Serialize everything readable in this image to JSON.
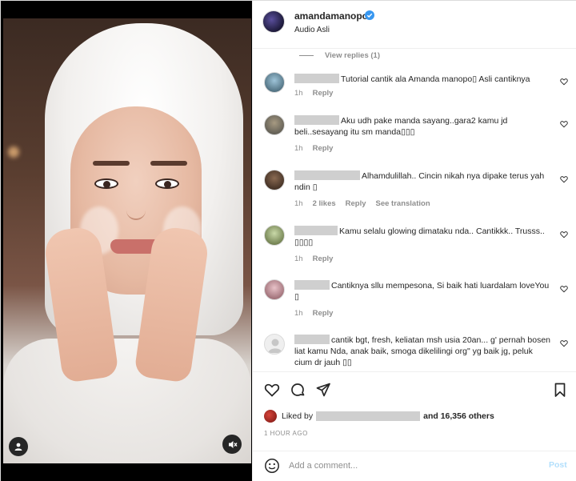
{
  "post": {
    "username": "amandamanopo",
    "audio": "Audio Asli",
    "view_replies": "View replies (1)"
  },
  "comments": [
    {
      "text": "Tutorial cantik ala Amanda manopo▯ Asli cantiknya",
      "time": "1h",
      "likes": "",
      "reply": "Reply",
      "translate": ""
    },
    {
      "text": "Aku udh pake manda sayang..gara2 kamu jd beli..sesayang itu sm manda▯▯▯",
      "time": "1h",
      "likes": "",
      "reply": "Reply",
      "translate": ""
    },
    {
      "text": "Alhamdulillah.. Cincin nikah nya dipake terus yah ndin ▯",
      "time": "1h",
      "likes": "2 likes",
      "reply": "Reply",
      "translate": "See translation"
    },
    {
      "text": "Kamu selalu glowing dimataku nda.. Cantikkk.. Trusss.. ▯▯▯▯",
      "time": "1h",
      "likes": "",
      "reply": "Reply",
      "translate": ""
    },
    {
      "text": "Cantiknya sllu mempesona, Si baik hati luardalam loveYou ▯",
      "time": "1h",
      "likes": "",
      "reply": "Reply",
      "translate": ""
    },
    {
      "text": "cantik bgt, fresh, keliatan msh usia 20an... g' pernah bosen liat kamu Nda, anak baik, smoga dikelilingi org\" yg baik jg, peluk cium dr jauh ▯▯",
      "time": "",
      "likes": "",
      "reply": "",
      "translate": ""
    }
  ],
  "likes": {
    "prefix": "Liked by",
    "others": "and 16,356 others"
  },
  "time_ago": "1 HOUR AGO",
  "add_comment": {
    "placeholder": "Add a comment...",
    "post_label": "Post"
  },
  "colors": {
    "accent": "#0095f6",
    "post_disabled": "#b2dffc",
    "muted": "#8e8e8e",
    "verified": "#3897f0"
  }
}
